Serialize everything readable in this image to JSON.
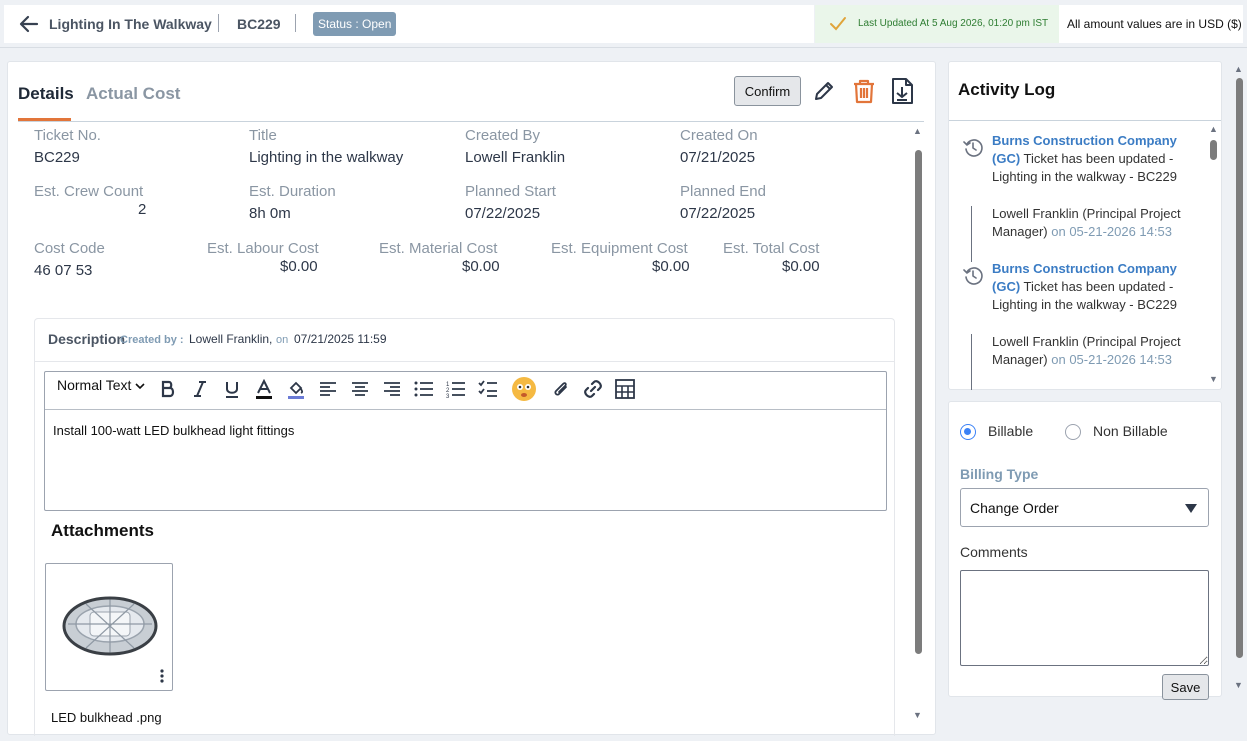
{
  "header": {
    "title": "Lighting In The Walkway",
    "ticket_id": "BC229",
    "status": "Status : Open",
    "last_updated": "Last Updated At 5 Aug 2026, 01:20 pm IST",
    "currency_note": "All amount values are in USD ($)"
  },
  "tabs": [
    {
      "label": "Details",
      "active": true
    },
    {
      "label": "Actual Cost",
      "active": false
    }
  ],
  "toolbar": {
    "confirm_label": "Confirm",
    "icons": [
      "edit-icon",
      "trash-icon",
      "download-icon"
    ],
    "accent_color": "#e2753a"
  },
  "details": {
    "ticket_no": {
      "label": "Ticket No.",
      "value": "BC229"
    },
    "title": {
      "label": "Title",
      "value": "Lighting in the walkway"
    },
    "created_by": {
      "label": "Created By",
      "value": "Lowell Franklin"
    },
    "created_on": {
      "label": "Created On",
      "value": "07/21/2025"
    },
    "crew_count": {
      "label": "Est. Crew Count",
      "value": "2"
    },
    "duration": {
      "label": "Est. Duration",
      "value": "8h 0m"
    },
    "planned_start": {
      "label": "Planned Start",
      "value": "07/22/2025"
    },
    "planned_end": {
      "label": "Planned End",
      "value": "07/22/2025"
    },
    "cost_code": {
      "label": "Cost Code",
      "value": "46 07 53"
    },
    "labour_cost": {
      "label": "Est. Labour Cost",
      "value": "$0.00"
    },
    "material_cost": {
      "label": "Est. Material Cost",
      "value": "$0.00"
    },
    "equipment_cost": {
      "label": "Est. Equipment Cost",
      "value": "$0.00"
    },
    "total_cost": {
      "label": "Est. Total Cost",
      "value": "$0.00"
    }
  },
  "description": {
    "title": "Description",
    "created_by_label": "Created by :",
    "author": "Lowell Franklin,",
    "on_label": "on",
    "date": "07/21/2025 11:59",
    "format_select": "Normal Text",
    "body": "Install 100-watt LED bulkhead light fittings"
  },
  "attachments": {
    "title": "Attachments",
    "items": [
      {
        "name": "LED bulkhead .png"
      }
    ]
  },
  "activity_log": {
    "title": "Activity Log",
    "entries": [
      {
        "company": "Burns Construction Company (GC)",
        "message": " Ticket has been updated - Lighting in the walkway - BC229",
        "author": "Lowell Franklin (Principal Project Manager)",
        "on": " on 05-21-2026 14:53"
      },
      {
        "company": "Burns Construction Company (GC)",
        "message": " Ticket has been updated - Lighting in the walkway - BC229",
        "author": "Lowell Franklin (Principal Project Manager)",
        "on": " on 05-21-2026 14:53"
      }
    ]
  },
  "billing": {
    "options": [
      {
        "label": "Billable",
        "selected": true
      },
      {
        "label": "Non Billable",
        "selected": false
      }
    ],
    "type_label": "Billing Type",
    "type_value": "Change Order",
    "comments_label": "Comments",
    "comments_value": "",
    "save_label": "Save"
  }
}
